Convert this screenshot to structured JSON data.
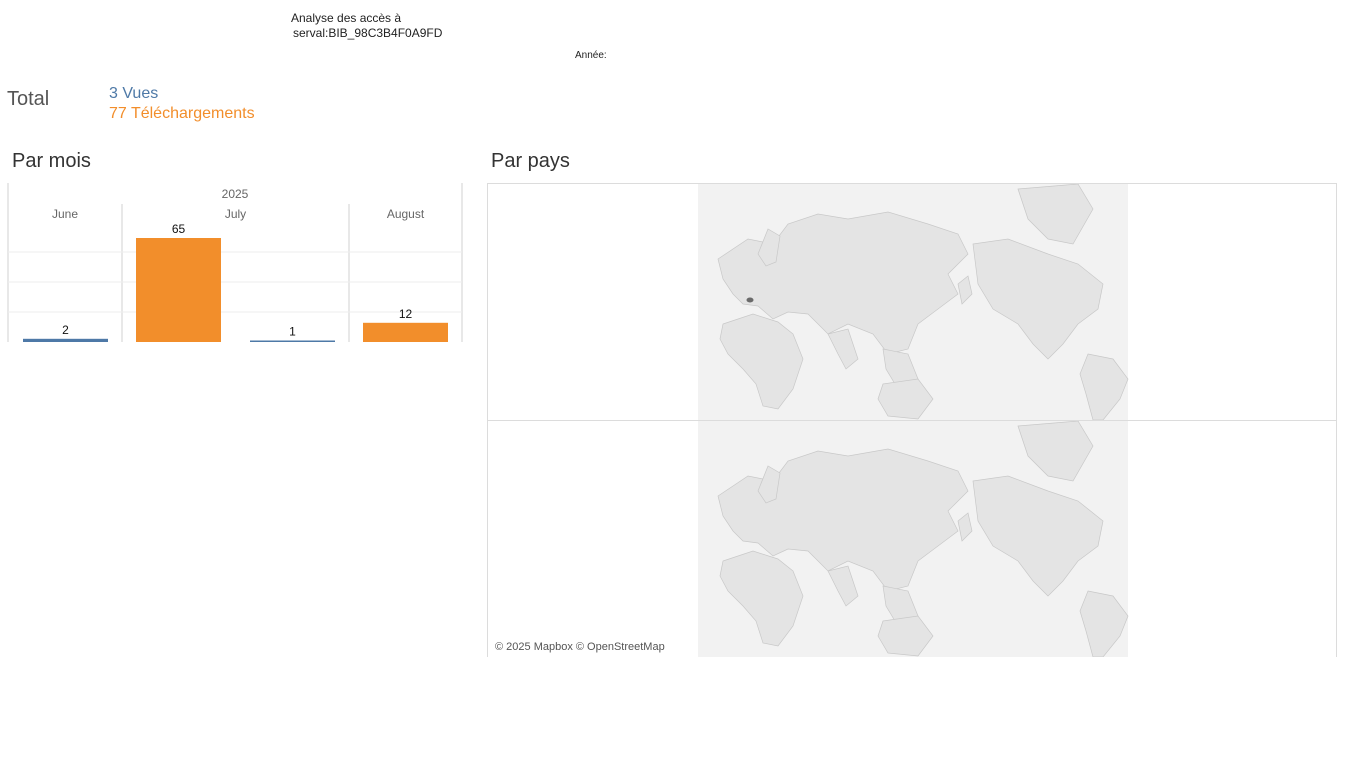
{
  "header": {
    "title_line1": "Analyse des accès à",
    "title_line2": "serval:BIB_98C3B4F0A9FD",
    "year_label": "Année:"
  },
  "totals": {
    "label": "Total",
    "views": "3 Vues",
    "downloads": "77 Téléchargements",
    "views_color": "#4e79a7",
    "downloads_color": "#f28e2b"
  },
  "sections": {
    "by_month_title": "Par mois",
    "by_country_title": "Par pays"
  },
  "map": {
    "credit": "© 2025 Mapbox © OpenStreetMap",
    "highlighted_country": "Switzerland"
  },
  "chart_data": {
    "type": "bar",
    "year": "2025",
    "categories": [
      "June",
      "July",
      "August"
    ],
    "series": [
      {
        "name": "Vues",
        "color": "#4e79a7",
        "values": [
          2,
          1,
          null
        ]
      },
      {
        "name": "Téléchargements",
        "color": "#f28e2b",
        "values": [
          null,
          65,
          12
        ]
      }
    ],
    "data_labels": {
      "June": [
        "2"
      ],
      "July": [
        "65",
        "1"
      ],
      "August": [
        "12"
      ]
    },
    "ylim": [
      0,
      65
    ],
    "grid": true
  }
}
